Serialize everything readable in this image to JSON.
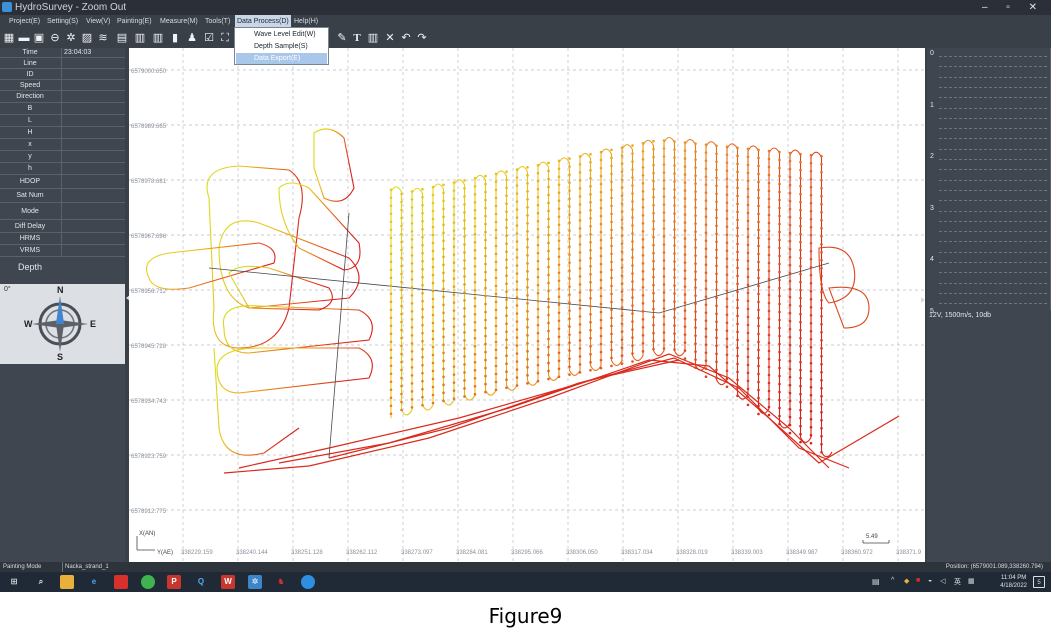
{
  "window": {
    "title": "HydroSurvey - Zoom Out",
    "controls": [
      "–",
      "▫",
      "✕"
    ]
  },
  "menubar": {
    "items": [
      "Project(E)",
      "Setting(S)",
      "View(V)",
      "Painting(E)",
      "Measure(M)",
      "Tools(T)",
      "Data Process(D)",
      "Help(H)"
    ],
    "active": "Data Process(D)"
  },
  "dropdown": {
    "items": [
      "Wave Level Edit(W)",
      "Depth Sample(S)",
      "Data Export(E)"
    ],
    "highlighted": "Data Export(E)"
  },
  "left_panel": {
    "time_label": "Time",
    "time_value": "23:04:03",
    "fields": [
      "Line",
      "ID",
      "Speed",
      "Direction",
      "B",
      "L",
      "H",
      "x",
      "y",
      "h",
      "HDOP",
      "Sat Num",
      "Mode",
      "Diff Delay",
      "HRMS",
      "VRMS"
    ],
    "depth_label": "Depth"
  },
  "compass": {
    "heading": "0°",
    "n": "N",
    "s": "S",
    "e": "E",
    "w": "W"
  },
  "map": {
    "y_ticks": [
      "6579000.650",
      "6578989.665",
      "6578978.681",
      "6578967.696",
      "6578956.712",
      "6578945.728",
      "6578934.743",
      "6578923.759",
      "6578912.775"
    ],
    "x_ticks": [
      "338229.159",
      "338240.144",
      "338251.128",
      "338262.112",
      "338273.097",
      "338284.081",
      "338295.066",
      "338306.050",
      "338317.034",
      "338328.019",
      "338339.003",
      "338349.987",
      "338360.972",
      "338371.9"
    ],
    "axis_y_label": "X(AN)",
    "axis_x_label": "Y(AE)",
    "scale_label": "5.49"
  },
  "depth_scale": {
    "ticks": [
      "0",
      "1",
      "2",
      "3",
      "4",
      "5"
    ],
    "params": "12V, 1500m/s, 10db"
  },
  "statusbar": {
    "mode": "Painting Mode",
    "file": "Nacka_strand_1",
    "position": "Position: (6579001.089,338260.794)"
  },
  "taskbar": {
    "lang": "英",
    "time": "11:04 PM",
    "date": "4/18/2022",
    "notification_count": "5"
  },
  "caption": "Figure9"
}
